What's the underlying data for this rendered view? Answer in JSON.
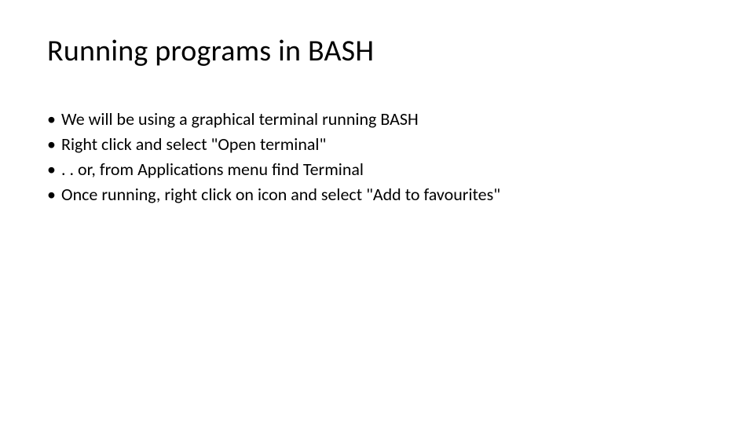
{
  "slide": {
    "title": "Running programs in BASH",
    "bullets": [
      "We will be using a graphical terminal running BASH",
      "Right click and select \"Open terminal\"",
      ". . or, from Applications menu find Terminal",
      "Once running, right click on icon and select \"Add to favourites\""
    ]
  }
}
